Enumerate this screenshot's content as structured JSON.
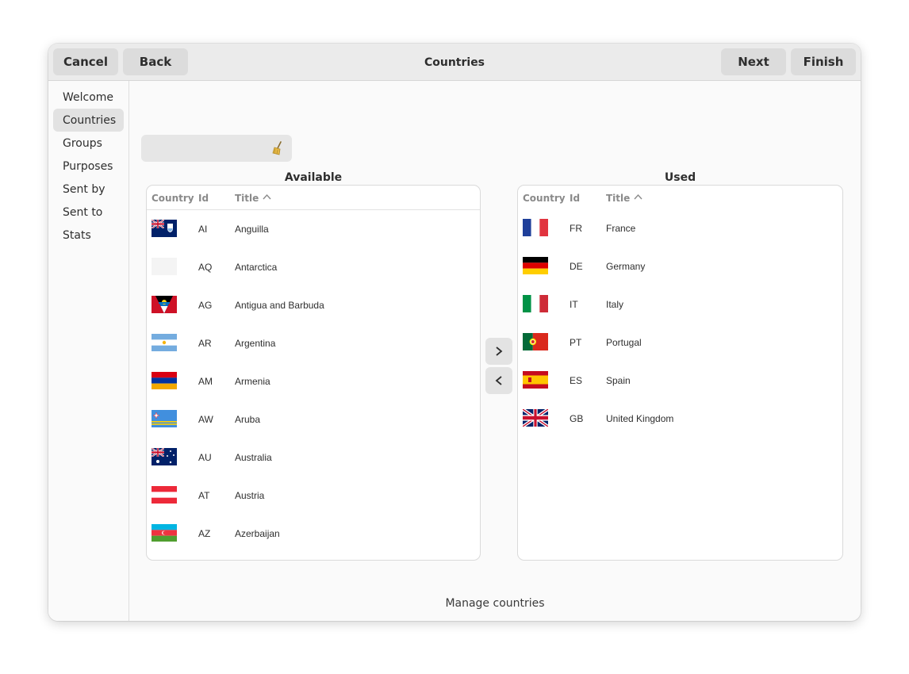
{
  "header": {
    "title": "Countries",
    "cancel_label": "Cancel",
    "back_label": "Back",
    "next_label": "Next",
    "finish_label": "Finish"
  },
  "sidebar": {
    "items": [
      {
        "label": "Welcome"
      },
      {
        "label": "Countries",
        "active": true
      },
      {
        "label": "Groups"
      },
      {
        "label": "Purposes"
      },
      {
        "label": "Sent by"
      },
      {
        "label": "Sent to"
      },
      {
        "label": "Stats"
      }
    ]
  },
  "search": {
    "value": "",
    "placeholder": ""
  },
  "columns": {
    "country": "Country",
    "id": "Id",
    "title": "Title"
  },
  "available": {
    "caption": "Available",
    "rows": [
      {
        "flag": "anguilla-flag",
        "id": "AI",
        "title": "Anguilla"
      },
      {
        "flag": "antarctica-flag",
        "id": "AQ",
        "title": "Antarctica"
      },
      {
        "flag": "antigua-and-barbuda-flag",
        "id": "AG",
        "title": "Antigua and Barbuda"
      },
      {
        "flag": "argentina-flag",
        "id": "AR",
        "title": "Argentina"
      },
      {
        "flag": "armenia-flag",
        "id": "AM",
        "title": "Armenia"
      },
      {
        "flag": "aruba-flag",
        "id": "AW",
        "title": "Aruba"
      },
      {
        "flag": "australia-flag",
        "id": "AU",
        "title": "Australia"
      },
      {
        "flag": "austria-flag",
        "id": "AT",
        "title": "Austria"
      },
      {
        "flag": "azerbaijan-flag",
        "id": "AZ",
        "title": "Azerbaijan"
      }
    ]
  },
  "used": {
    "caption": "Used",
    "rows": [
      {
        "flag": "france-flag",
        "id": "FR",
        "title": "France"
      },
      {
        "flag": "germany-flag",
        "id": "DE",
        "title": "Germany"
      },
      {
        "flag": "italy-flag",
        "id": "IT",
        "title": "Italy"
      },
      {
        "flag": "portugal-flag",
        "id": "PT",
        "title": "Portugal"
      },
      {
        "flag": "spain-flag",
        "id": "ES",
        "title": "Spain"
      },
      {
        "flag": "united-kingdom-flag",
        "id": "GB",
        "title": "United Kingdom"
      }
    ]
  },
  "status": "Manage countries",
  "icons": {
    "add": "chevron-right-icon",
    "remove": "chevron-left-icon",
    "clear": "broom-icon",
    "sort": "sort-ascending-icon"
  }
}
